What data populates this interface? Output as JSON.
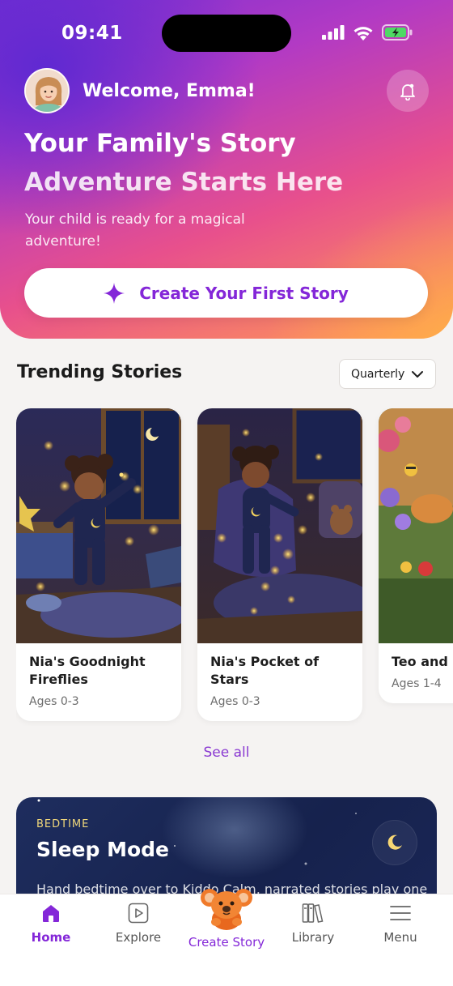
{
  "status_bar": {
    "time": "09:41"
  },
  "header": {
    "welcome": "Welcome, Emma!",
    "title_line1": "Your Family's Story",
    "title_line2": "Adventure Starts Here",
    "subtitle": "Your child is ready for a magical adventure!",
    "cta_label": "Create Your First Story"
  },
  "trending": {
    "title": "Trending Stories",
    "filter": {
      "selected": "Quarterly"
    },
    "stories": [
      {
        "title": "Nia's Goodnight Fireflies",
        "ages": "Ages 0-3"
      },
      {
        "title": "Nia's Pocket of Stars",
        "ages": "Ages 0-3"
      },
      {
        "title": "Teo and Bumble",
        "ages": "Ages 1-4"
      }
    ],
    "see_all": "See all"
  },
  "sleep_mode": {
    "tag": "BEDTIME",
    "title": "Sleep Mode",
    "description": "Hand bedtime over to Kiddo Calm, narrated stories play one"
  },
  "bottom_nav": {
    "items": [
      {
        "label": "Home",
        "icon": "home-icon",
        "active": true
      },
      {
        "label": "Explore",
        "icon": "play-icon",
        "active": false
      },
      {
        "label": "Create Story",
        "icon": "koala-mascot",
        "active": false
      },
      {
        "label": "Library",
        "icon": "books-icon",
        "active": false
      },
      {
        "label": "Menu",
        "icon": "menu-icon",
        "active": false
      }
    ]
  },
  "colors": {
    "accent": "#8427d8",
    "gradient_start": "#7b2fd2",
    "gradient_end": "#ff9a55",
    "sleep_bg": "#1e2d5e"
  }
}
